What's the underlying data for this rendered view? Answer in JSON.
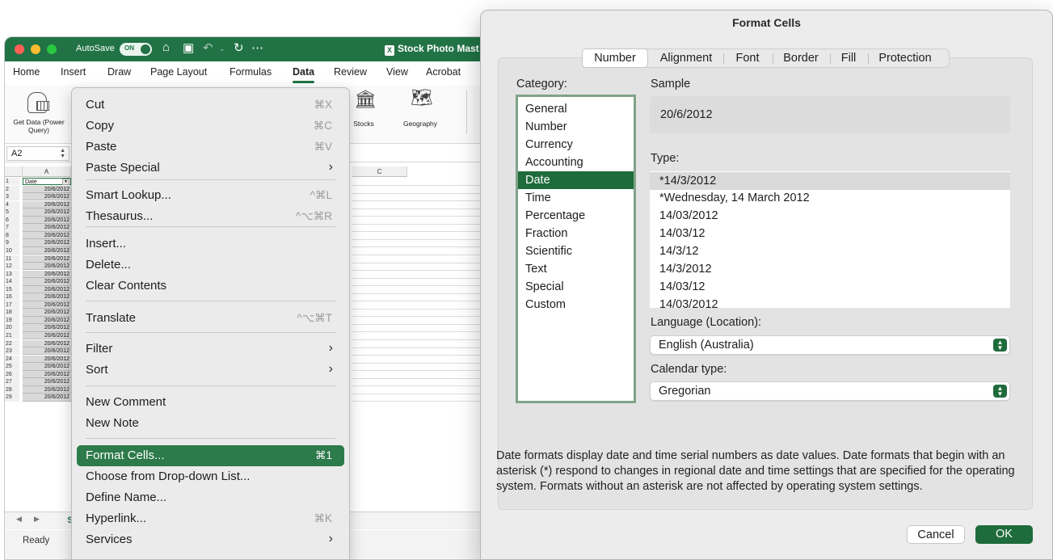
{
  "excel": {
    "autosave_label": "AutoSave",
    "autosave_state": "ON",
    "doc_title": "Stock Photo Mast",
    "ribbon_tabs": [
      "Home",
      "Insert",
      "Draw",
      "Page Layout",
      "Formulas",
      "Data",
      "Review",
      "View",
      "Acrobat"
    ],
    "active_tab": "Data",
    "ribbon": {
      "get_data_label": "Get Data (Power Query)",
      "stocks_label": "Stocks",
      "geography_label": "Geography"
    },
    "name_box": "A2",
    "columns": [
      "A",
      "C"
    ],
    "header_cell": "Date",
    "rows": [
      "1",
      "2",
      "3",
      "4",
      "5",
      "6",
      "7",
      "8",
      "9",
      "10",
      "11",
      "12",
      "13",
      "14",
      "15",
      "16",
      "17",
      "18",
      "19",
      "20",
      "21",
      "22",
      "23",
      "24",
      "25",
      "26",
      "27",
      "28",
      "29"
    ],
    "date_value": "20/6/2012",
    "sheet_tab": "S",
    "status": "Ready"
  },
  "context_menu": {
    "items": [
      {
        "label": "Cut",
        "shortcut": "⌘X"
      },
      {
        "label": "Copy",
        "shortcut": "⌘C"
      },
      {
        "label": "Paste",
        "shortcut": "⌘V"
      },
      {
        "label": "Paste Special",
        "submenu": ">"
      },
      {
        "label": "Smart Lookup...",
        "shortcut": "^⌘L"
      },
      {
        "label": "Thesaurus...",
        "shortcut": "^⌥⌘R"
      },
      {
        "label": "Insert..."
      },
      {
        "label": "Delete..."
      },
      {
        "label": "Clear Contents"
      },
      {
        "label": "Translate",
        "shortcut": "^⌥⌘T"
      },
      {
        "label": "Filter",
        "submenu": ">"
      },
      {
        "label": "Sort",
        "submenu": ">"
      },
      {
        "label": "New Comment"
      },
      {
        "label": "New Note"
      },
      {
        "label": "Format Cells...",
        "shortcut": "⌘1"
      },
      {
        "label": "Choose from Drop-down List..."
      },
      {
        "label": "Define Name..."
      },
      {
        "label": "Hyperlink...",
        "shortcut": "⌘K"
      },
      {
        "label": "Services",
        "submenu": ">"
      }
    ],
    "highlighted": "Format Cells...",
    "highlight_color": "#2d7a4a"
  },
  "dialog": {
    "title": "Format Cells",
    "tabs": [
      "Number",
      "Alignment",
      "Font",
      "Border",
      "Fill",
      "Protection"
    ],
    "active_tab": "Number",
    "category_label": "Category:",
    "categories": [
      "General",
      "Number",
      "Currency",
      "Accounting",
      "Date",
      "Time",
      "Percentage",
      "Fraction",
      "Scientific",
      "Text",
      "Special",
      "Custom"
    ],
    "selected_category": "Date",
    "sample_label": "Sample",
    "sample_value": "20/6/2012",
    "type_label": "Type:",
    "types": [
      "*14/3/2012",
      "*Wednesday, 14 March 2012",
      "14/03/2012",
      "14/03/12",
      "14/3/12",
      "14/3/2012",
      "14/03/12",
      "14/03/2012"
    ],
    "selected_type": "*14/3/2012",
    "language_label": "Language (Location):",
    "language_value": "English (Australia)",
    "calendar_label": "Calendar type:",
    "calendar_value": "Gregorian",
    "description": "Date formats display date and time serial numbers as date values.  Date formats that begin with an asterisk (*) respond to changes in regional date and time settings that are specified for the operating system. Formats without an asterisk are not affected by operating system settings.",
    "cancel_label": "Cancel",
    "ok_label": "OK",
    "accent_color": "#1e6b3b"
  }
}
